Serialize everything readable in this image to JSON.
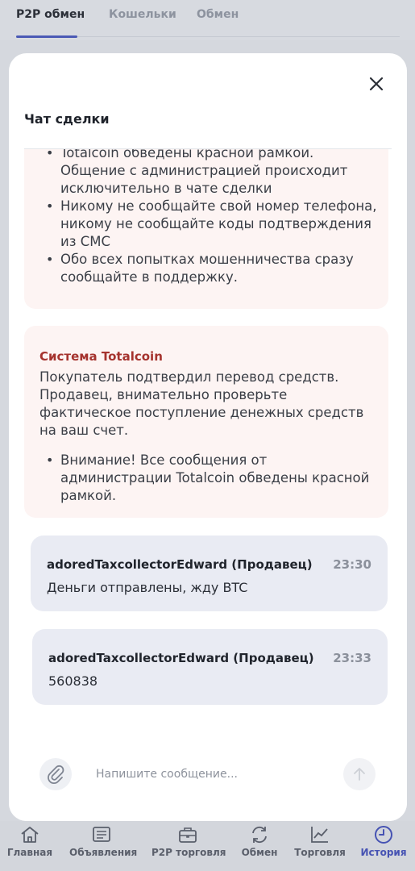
{
  "top_tabs": [
    "P2P обмен",
    "Кошельки",
    "Обмен"
  ],
  "modal": {
    "title": "Чат сделки"
  },
  "system_card_1": {
    "lines": [
      "Totalcoin обведены красной рамкой. Общение с администрацией происходит исключительно в чате сделки",
      "Никому не сообщайте свой номер телефона, никому не сообщайте коды подтверждения из СМС",
      "Обо всех попытках мошенничества сразу сообщайте в поддержку."
    ]
  },
  "system_card_2": {
    "sender": "Система Totalcoin",
    "text": "Покупатель подтвердил перевод средств. Продавец, внимательно проверьте фактическое поступление денежных средств на ваш счет.",
    "bullets": [
      "Внимание! Все сообщения от администрации Totalcoin обведены красной рамкой."
    ]
  },
  "messages": [
    {
      "author": "adoredTaxcollectorEdward (Продавец)",
      "time": "23:30",
      "text": "Деньги отправлены, жду BTC"
    },
    {
      "author": "adoredTaxcollectorEdward (Продавец)",
      "time": "23:33",
      "text": "560838"
    }
  ],
  "composer": {
    "placeholder": "Напишите сообщение...",
    "value": ""
  },
  "bottom_nav": [
    {
      "label": "Главная",
      "icon": "home-icon"
    },
    {
      "label": "Объявления",
      "icon": "ads-icon"
    },
    {
      "label": "P2P торговля",
      "icon": "briefcase-icon"
    },
    {
      "label": "Обмен",
      "icon": "exchange-icon"
    },
    {
      "label": "Торговля",
      "icon": "chart-icon"
    },
    {
      "label": "История",
      "icon": "clock-icon",
      "active": true
    }
  ],
  "colors": {
    "accent": "#4653b3",
    "system_sender": "#a5332e",
    "system_bg": "#fdf4f3",
    "message_bg": "#e9ebf3"
  }
}
